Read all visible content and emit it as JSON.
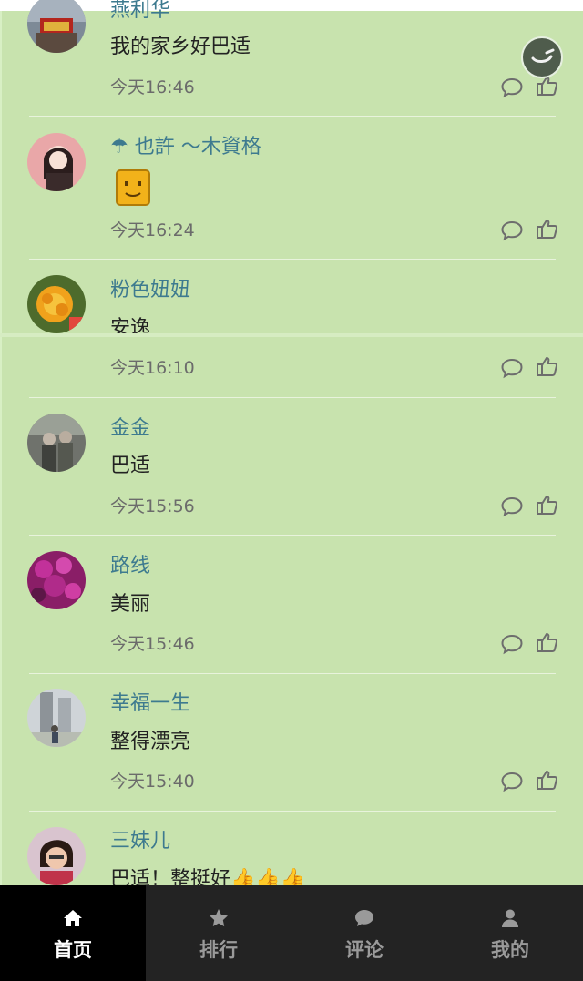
{
  "comments": [
    {
      "user": "燕利华",
      "text": "我的家乡好巴适",
      "time": "今天16:46"
    },
    {
      "user": "☂ 也許 ～木資格",
      "text": "",
      "time": "今天16:24"
    },
    {
      "user": "粉色妞妞",
      "text": "安逸",
      "time": "今天16:10"
    },
    {
      "user": "金金",
      "text": "巴适",
      "time": "今天15:56"
    },
    {
      "user": "路线",
      "text": "美丽",
      "time": "今天15:46"
    },
    {
      "user": "幸福一生",
      "text": "整得漂亮",
      "time": "今天15:40"
    },
    {
      "user": "三妹儿",
      "text": "巴适！整挺好👍👍👍",
      "time": ""
    }
  ],
  "nav": {
    "items": [
      {
        "label": "首页",
        "icon": "home-icon"
      },
      {
        "label": "排行",
        "icon": "star-icon"
      },
      {
        "label": "评论",
        "icon": "chat-icon"
      },
      {
        "label": "我的",
        "icon": "user-icon"
      }
    ],
    "active": 0
  },
  "colors": {
    "background": "#c8e3ae",
    "username": "#3d7a8f",
    "nav_bg": "#232323",
    "nav_active": "#000000"
  }
}
